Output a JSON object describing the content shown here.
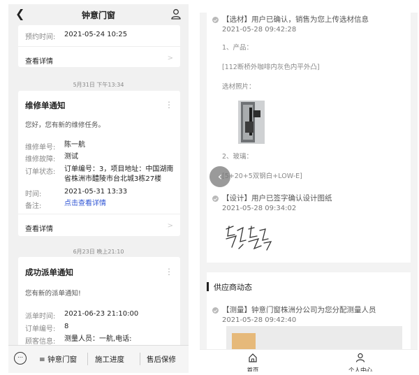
{
  "left": {
    "header": {
      "title": "钟意门窗"
    },
    "card0": {
      "rows": [
        {
          "label": "预约时间:",
          "value": "2021-05-24 10:25"
        }
      ],
      "detail": "查看详情"
    },
    "sep1": "5月31日 下午13:34",
    "card1": {
      "title": "维修单通知",
      "desc": "您好，您有新的维修任务。",
      "rows": [
        {
          "label": "维修单号:",
          "value": "陈一航"
        },
        {
          "label": "维修故障:",
          "value": "测试"
        },
        {
          "label": "订单状态:",
          "value": "订单编号：3，项目地址：中国湖南省株洲市醴陵市台北城3栋27楼"
        },
        {
          "label": "时间:",
          "value": "2021-05-31 13:33"
        },
        {
          "label": "备注:",
          "value": "点击查看详情"
        }
      ],
      "detail": "查看详情"
    },
    "sep2": "6月23日 晚上21:10",
    "card2": {
      "title": "成功派单通知",
      "desc": "您有新的派单通知!",
      "rows": [
        {
          "label": "派单时间:",
          "value": "2021-06-23 21:10:00"
        },
        {
          "label": "订单编号:",
          "value": "8"
        },
        {
          "label": "顾客信息:",
          "value": "测量人员：一航,电话:"
        }
      ]
    },
    "bottom_nav": {
      "btn1": "≡ 钟意门窗",
      "btn2": "施工进度",
      "btn3": "售后保修"
    }
  },
  "right": {
    "entry1": {
      "text": "【选材】用户已确认，销售为您上传选材信息",
      "time": "2021-05-28 09:42:28",
      "l1": "1、产品：",
      "l2": "[112断桥外咖啡内灰色内平外凸]",
      "l3": "选材照片：",
      "l4": "2、玻璃：",
      "l5": "[5+20+5双钢白+LOW-E]"
    },
    "entry2": {
      "text": "【设计】用户已签字确认设计图纸",
      "time": "2021-05-28 09:34:02"
    },
    "section": {
      "title": "供应商动态",
      "entry_text": "【测量】钟意门窗株洲分公司为您分配测量人员",
      "entry_time": "2021-05-28 09:42:40"
    },
    "nav": {
      "home": "首页",
      "profile": "个人中心"
    }
  }
}
